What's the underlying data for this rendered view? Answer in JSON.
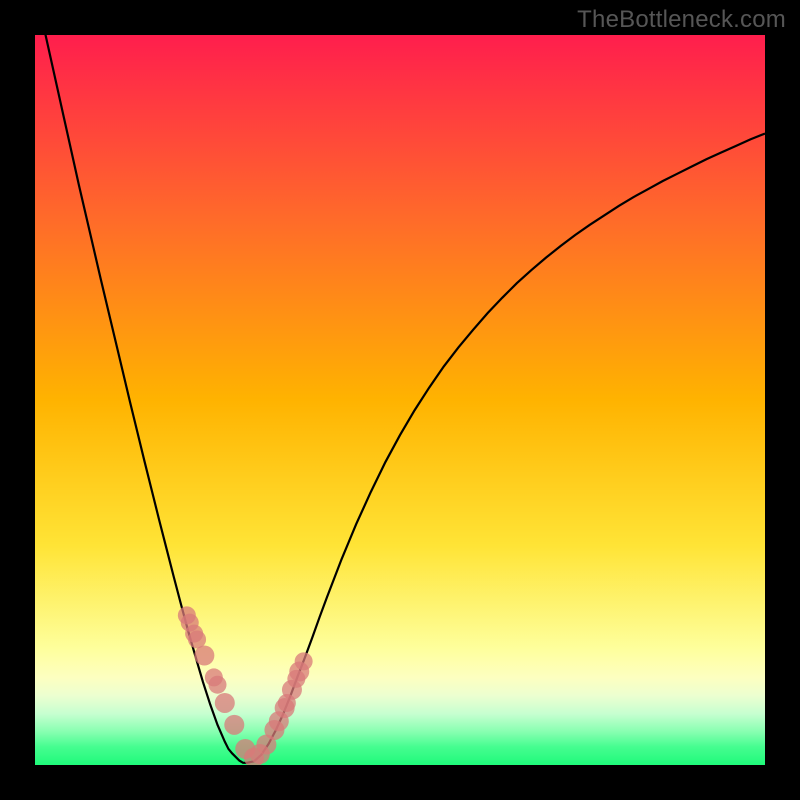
{
  "watermark": "TheBottleneck.com",
  "colors": {
    "frame_bg": "#000000",
    "gradient_top": "#ff1e4d",
    "gradient_mid1": "#ffb300",
    "gradient_mid2": "#ffe436",
    "gradient_pale": "#feff9c",
    "gradient_bottom": "#1ffa7a",
    "curve": "#000000",
    "dot_fill": "#d87a7a",
    "dot_stroke": "#a64747"
  },
  "chart_data": {
    "type": "line",
    "title": "",
    "xlabel": "",
    "ylabel": "",
    "x_range": [
      0,
      1
    ],
    "y_range": [
      0,
      1
    ],
    "series": [
      {
        "name": "bottleneck-curve",
        "x": [
          0.0,
          0.01,
          0.02,
          0.03,
          0.04,
          0.05,
          0.06,
          0.07,
          0.08,
          0.09,
          0.1,
          0.11,
          0.12,
          0.13,
          0.14,
          0.15,
          0.16,
          0.17,
          0.18,
          0.19,
          0.2,
          0.21,
          0.22,
          0.23,
          0.24,
          0.25,
          0.26,
          0.265,
          0.27,
          0.28,
          0.285,
          0.29,
          0.3,
          0.31,
          0.32,
          0.33,
          0.34,
          0.35,
          0.36,
          0.37,
          0.38,
          0.39,
          0.4,
          0.41,
          0.42,
          0.43,
          0.44,
          0.46,
          0.48,
          0.5,
          0.52,
          0.54,
          0.56,
          0.58,
          0.6,
          0.62,
          0.64,
          0.66,
          0.68,
          0.7,
          0.72,
          0.74,
          0.76,
          0.78,
          0.8,
          0.82,
          0.84,
          0.86,
          0.88,
          0.9,
          0.92,
          0.94,
          0.96,
          0.98,
          1.0
        ],
        "y": [
          1.06,
          1.02,
          0.975,
          0.93,
          0.885,
          0.84,
          0.795,
          0.752,
          0.709,
          0.666,
          0.624,
          0.582,
          0.54,
          0.498,
          0.457,
          0.416,
          0.376,
          0.336,
          0.297,
          0.258,
          0.22,
          0.183,
          0.148,
          0.114,
          0.083,
          0.055,
          0.032,
          0.022,
          0.016,
          0.006,
          0.003,
          0.003,
          0.005,
          0.014,
          0.029,
          0.048,
          0.07,
          0.095,
          0.122,
          0.148,
          0.175,
          0.203,
          0.23,
          0.256,
          0.282,
          0.306,
          0.33,
          0.374,
          0.415,
          0.452,
          0.486,
          0.517,
          0.546,
          0.572,
          0.596,
          0.619,
          0.64,
          0.66,
          0.678,
          0.695,
          0.711,
          0.726,
          0.74,
          0.753,
          0.766,
          0.778,
          0.789,
          0.8,
          0.81,
          0.82,
          0.83,
          0.839,
          0.848,
          0.857,
          0.865
        ]
      }
    ],
    "markers": {
      "name": "highlight-dots",
      "x": [
        0.208,
        0.212,
        0.218,
        0.222,
        0.232,
        0.245,
        0.25,
        0.26,
        0.273,
        0.288,
        0.3,
        0.308,
        0.317,
        0.328,
        0.334,
        0.342,
        0.345,
        0.352,
        0.358,
        0.362,
        0.368
      ],
      "y": [
        0.205,
        0.195,
        0.18,
        0.172,
        0.15,
        0.12,
        0.11,
        0.085,
        0.055,
        0.022,
        0.01,
        0.015,
        0.028,
        0.048,
        0.06,
        0.078,
        0.085,
        0.103,
        0.118,
        0.128,
        0.142
      ],
      "r": [
        9,
        9,
        9,
        9,
        10,
        9,
        9,
        10,
        10,
        10,
        10,
        10,
        10,
        10,
        10,
        10,
        9,
        10,
        9,
        10,
        9
      ]
    },
    "gradient_stops": [
      {
        "offset": 0.0,
        "color": "#ff1e4d"
      },
      {
        "offset": 0.25,
        "color": "#ff6a2a"
      },
      {
        "offset": 0.5,
        "color": "#ffb300"
      },
      {
        "offset": 0.7,
        "color": "#ffe436"
      },
      {
        "offset": 0.84,
        "color": "#feff9c"
      },
      {
        "offset": 0.88,
        "color": "#fdffc0"
      },
      {
        "offset": 0.905,
        "color": "#ecffd0"
      },
      {
        "offset": 0.93,
        "color": "#c6ffd0"
      },
      {
        "offset": 0.955,
        "color": "#86ffb0"
      },
      {
        "offset": 0.975,
        "color": "#46fd90"
      },
      {
        "offset": 1.0,
        "color": "#1ffa7a"
      }
    ]
  }
}
